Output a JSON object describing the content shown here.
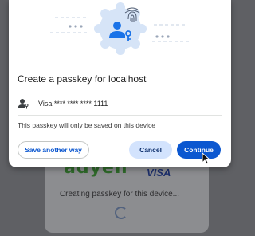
{
  "background": {
    "logo": "adyen",
    "card_brand": "VISA",
    "status": "Creating passkey for this device..."
  },
  "dialog": {
    "title": "Create a passkey for localhost",
    "account": {
      "icon": "person-key-icon",
      "text": "Visa **** **** **** 1111"
    },
    "notice": "This passkey will only be saved on this device",
    "buttons": {
      "another": "Save another way",
      "cancel": "Cancel",
      "continue": "Continue"
    }
  },
  "colors": {
    "accent": "#0b57d0",
    "tonal": "#d3e3fd",
    "badge": "#d6e4f7",
    "icon_blue": "#1a73e8"
  }
}
